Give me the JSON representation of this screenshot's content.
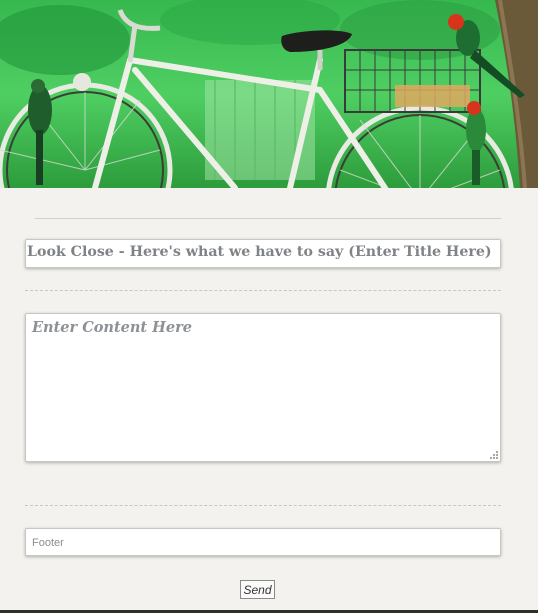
{
  "banner": {
    "image": "bicycle-photo",
    "description_colors": [
      "#3fbf55",
      "#1f8a34",
      "#e8e8e0",
      "#d23a1c"
    ]
  },
  "form": {
    "title_placeholder": "Look Close - Here's what we have to say (Enter Title Here)",
    "content_placeholder": "Enter Content Here",
    "footer_placeholder": "Footer",
    "send_label": "Send"
  },
  "colors": {
    "page_bg": "#f4f2ee",
    "placeholder_text": "#7f8286"
  }
}
